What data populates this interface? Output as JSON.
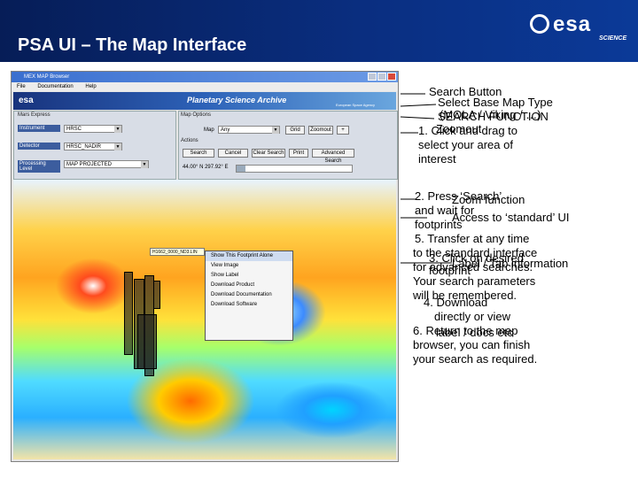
{
  "slide": {
    "title": "PSA UI – The Map Interface",
    "logo_text": "esa",
    "logo_sub": "SCIENCE"
  },
  "window": {
    "title": "MEX MAP Browser",
    "menu": [
      "File",
      "Documentation",
      "Help"
    ],
    "banner_left": "esa",
    "banner_center": "Planetary Science Archive",
    "banner_right": "European Space Agency"
  },
  "mars_express": {
    "panel_title": "Mars Express",
    "fields": [
      {
        "label": "Instrument",
        "value": "HRSC"
      },
      {
        "label": "Detector",
        "value": "HRSC_NADIR"
      },
      {
        "label": "Processing Level",
        "value": "MAP PROJECTED"
      }
    ]
  },
  "map_options": {
    "panel_title": "Map Options",
    "map_label": "Map",
    "map_value": "Any",
    "grid_label": "Grid",
    "zoomout_label": "Zoomout"
  },
  "actions": {
    "panel_title": "Actions",
    "buttons": [
      "Search",
      "Cancel",
      "Clear Search",
      "Print",
      "Advanced Search"
    ],
    "coordinates": "44.00° N  297.92° E",
    "progress_fraction": 0.08
  },
  "map": {
    "tooltip": "H1662_0000_ND3.LIN",
    "context_menu": [
      "Show This Footprint Alone",
      "View Image",
      "Show Label",
      "Download Product",
      "Download Documentation",
      "Download Software"
    ]
  },
  "annotations": [
    "Search Button",
    "Select Base Map Type",
    "(MOLA / Viking / …)",
    "SEARCH FUNCTION",
    "1. Click and drag to",
    "select your area of",
    "interest",
    "Zoomout",
    "2. Press ‘Search’",
    "and wait for",
    "footprints",
    "Zoom function",
    "Access to ‘standard’ UI",
    "5. Transfer at any time",
    "to the standard interface",
    "for advanced searches.",
    "Your search parameters",
    "will be remembered.",
    "3. Click on desired",
    "footprint",
    "Label / Tab information",
    "4. Download",
    "directly or view",
    "label / docs etc",
    "6. Return to the map",
    "browser, you can finish",
    "your search as required."
  ]
}
